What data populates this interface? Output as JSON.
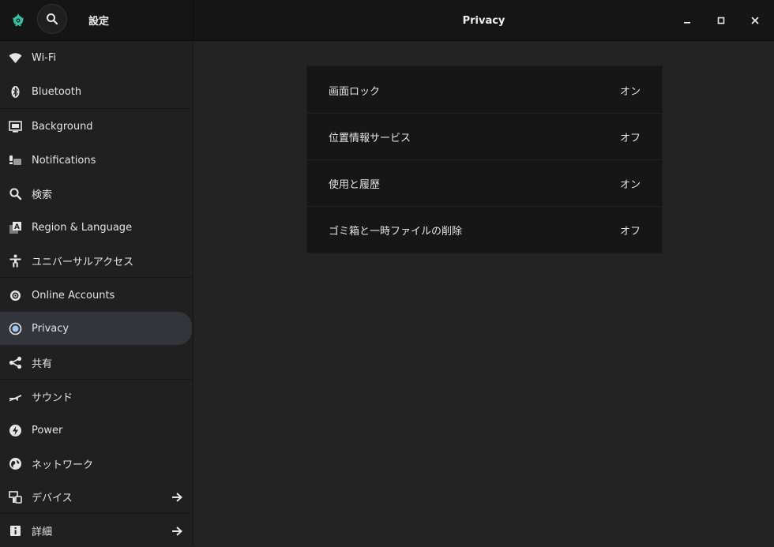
{
  "header": {
    "app_title": "設定",
    "page_title": "Privacy"
  },
  "sidebar": {
    "items": [
      {
        "label": "Wi-Fi",
        "icon": "wifi-icon"
      },
      {
        "label": "Bluetooth",
        "icon": "bluetooth-icon"
      },
      {
        "label": "Background",
        "icon": "background-icon"
      },
      {
        "label": "Notifications",
        "icon": "notifications-icon"
      },
      {
        "label": "検索",
        "icon": "search-icon"
      },
      {
        "label": "Region & Language",
        "icon": "region-language-icon"
      },
      {
        "label": "ユニバーサルアクセス",
        "icon": "accessibility-icon"
      },
      {
        "label": "Online Accounts",
        "icon": "online-accounts-icon"
      },
      {
        "label": "Privacy",
        "icon": "privacy-icon",
        "active": true
      },
      {
        "label": "共有",
        "icon": "share-icon"
      },
      {
        "label": "サウンド",
        "icon": "sound-icon"
      },
      {
        "label": "Power",
        "icon": "power-icon"
      },
      {
        "label": "ネットワーク",
        "icon": "network-icon"
      },
      {
        "label": "デバイス",
        "icon": "devices-icon",
        "has_arrow": true
      },
      {
        "label": "詳細",
        "icon": "details-icon",
        "has_arrow": true
      }
    ]
  },
  "privacy": {
    "rows": [
      {
        "label": "画面ロック",
        "value": "オン"
      },
      {
        "label": "位置情報サービス",
        "value": "オフ"
      },
      {
        "label": "使用と履歴",
        "value": "オン"
      },
      {
        "label": "ゴミ箱と一時ファイルの削除",
        "value": "オフ"
      }
    ]
  },
  "colors": {
    "background": "#232323",
    "sidebar": "#202020",
    "header": "#151515",
    "active_item": "#32353b",
    "panel": "#161616",
    "app_icon_accent": "#2ec4a5"
  }
}
